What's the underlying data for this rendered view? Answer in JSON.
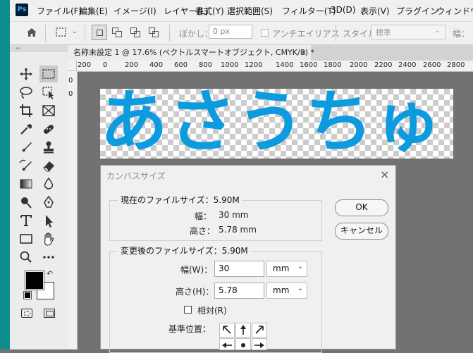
{
  "app": {
    "logo": "Ps"
  },
  "menu": [
    "ファイル(F)",
    "編集(E)",
    "イメージ(I)",
    "レイヤー(L)",
    "書式(Y)",
    "選択範囲(S)",
    "フィルター(T)",
    "3D(D)",
    "表示(V)",
    "プラグイン",
    "ウィンドウ(W)"
  ],
  "options": {
    "feather_label": "ぼかし：",
    "feather_value": "0 px",
    "antialias_label": "アンチエイリアス",
    "style_label": "スタイル：",
    "style_value": "標準",
    "width_label": "幅："
  },
  "document": {
    "tab_title": "名称未設定 1 @ 17.6% (ベクトルスマートオブジェクト, CMYK/8) *",
    "close": "×",
    "canvas_text": "あさうちゅ",
    "text_color": "#0d9be0"
  },
  "ruler": {
    "h_labels": [
      "200",
      "0",
      "200",
      "400",
      "600",
      "800",
      "1000",
      "1200",
      "1400",
      "1600",
      "1800",
      "2000",
      "2200",
      "2400",
      "2600",
      "2800"
    ],
    "v_labels": [
      "0",
      "0"
    ]
  },
  "dialog": {
    "title": "カンバスサイズ",
    "close": "×",
    "current_group": "現在のファイルサイズ：5.90M",
    "current_width_label": "幅：",
    "current_width_value": "30 mm",
    "current_height_label": "高さ：",
    "current_height_value": "5.78 mm",
    "new_group": "変更後のファイルサイズ：5.90M",
    "width_label": "幅(W)：",
    "width_value": "30",
    "width_unit": "mm",
    "height_label": "高さ(H)：",
    "height_value": "5.78",
    "height_unit": "mm",
    "relative_label": "相対(R)",
    "anchor_label": "基準位置：",
    "ok_label": "OK",
    "cancel_label": "キャンセル"
  },
  "colors": {
    "foreground": "#000000",
    "background": "#ffffff",
    "accent": "#0d9be0"
  }
}
